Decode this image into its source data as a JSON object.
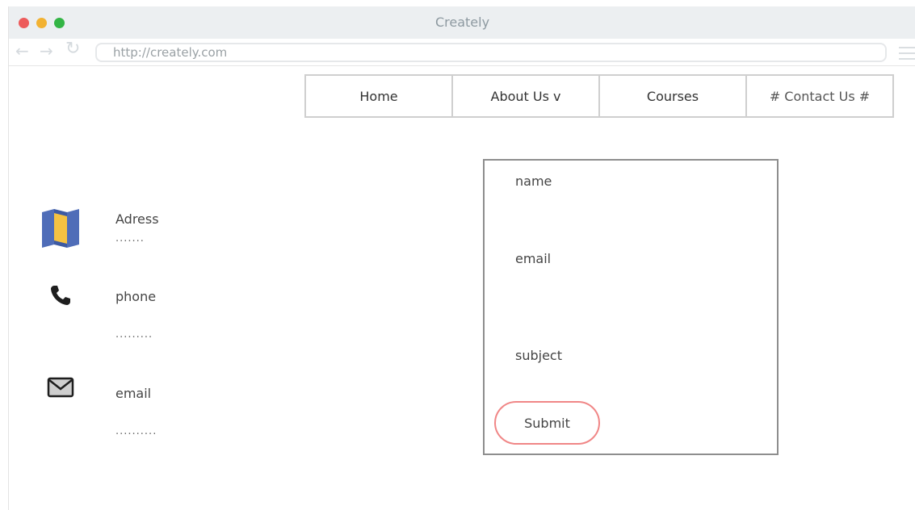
{
  "window": {
    "title": "Creately",
    "url": "http://creately.com"
  },
  "menu": {
    "items": [
      "Home",
      "About Us v",
      "Courses",
      "# Contact Us #"
    ]
  },
  "contact_info": {
    "address": {
      "label": "Adress",
      "value": "......."
    },
    "phone": {
      "label": "phone",
      "value": "........."
    },
    "email": {
      "label": "email",
      "value": ".........."
    }
  },
  "form": {
    "name_label": "name",
    "email_label": "email",
    "subject_label": "subject",
    "submit_label": "Submit"
  },
  "colors": {
    "dot_red": "#ed5b5b",
    "dot_yellow": "#f2b232",
    "dot_green": "#33b545",
    "submit_border": "#f08686",
    "map_icon_blue": "#4f6db8",
    "map_icon_yellow": "#f5c242"
  },
  "icons": [
    "map-icon",
    "phone-icon",
    "envelope-icon"
  ]
}
